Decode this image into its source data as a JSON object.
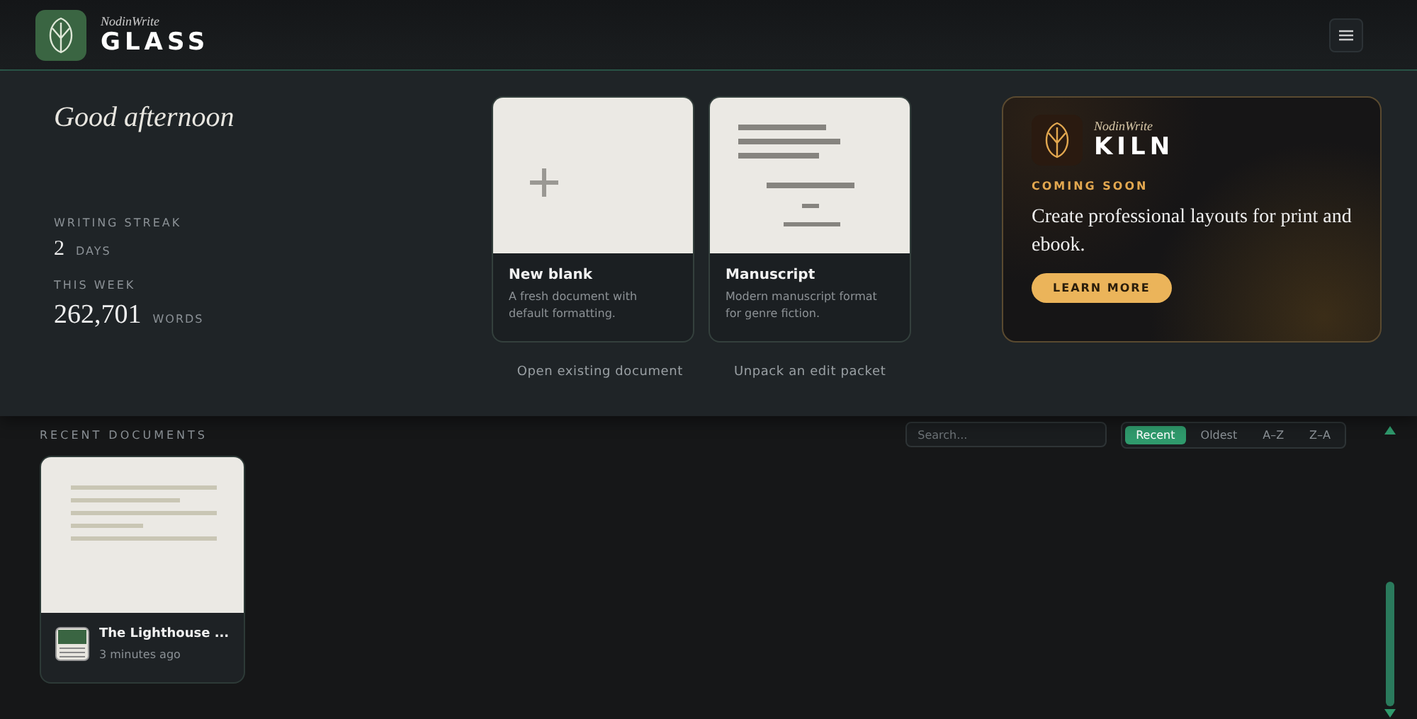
{
  "header": {
    "brand_small": "NodinWrite",
    "brand_large": "GLASS"
  },
  "greeting": "Good afternoon",
  "stats": [
    {
      "label": "WRITING STREAK",
      "value": "2",
      "unit": "DAYS"
    },
    {
      "label": "THIS WEEK",
      "value": "262,701",
      "unit": "WORDS"
    }
  ],
  "templates": [
    {
      "kind": "blank",
      "title": "New blank",
      "description": "A fresh document with default formatting."
    },
    {
      "kind": "manuscript",
      "title": "Manuscript",
      "description": "Modern manuscript format for genre fiction."
    }
  ],
  "links": [
    "Open existing document",
    "Unpack an edit packet"
  ],
  "promo": {
    "brand_small": "NodinWrite",
    "brand_large": "KILN",
    "badge": "COMING SOON",
    "text": "Create professional layouts for print and ebook.",
    "button": "LEARN MORE"
  },
  "recent": {
    "title": "RECENT DOCUMENTS",
    "search": {
      "placeholder": "Search..."
    },
    "sort_options": [
      {
        "label": "Recent",
        "selected": true
      },
      {
        "label": "Oldest",
        "selected": false
      },
      {
        "label": "A–Z",
        "selected": false
      },
      {
        "label": "Z–A",
        "selected": false
      }
    ],
    "documents": [
      {
        "title": "The Lighthouse ...",
        "time": "3 minutes ago"
      }
    ]
  }
}
